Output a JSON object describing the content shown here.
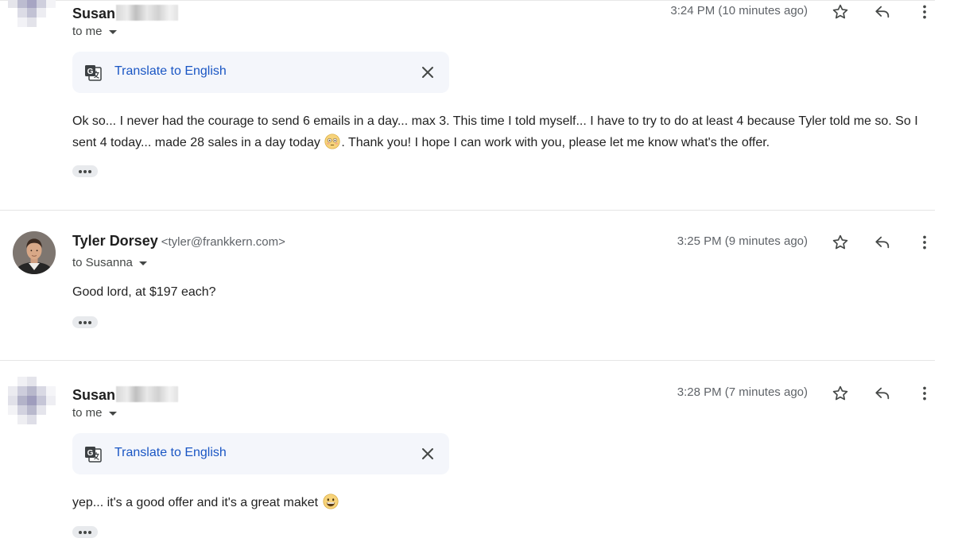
{
  "messages": [
    {
      "sender_name": "Susan",
      "sender_email": "",
      "to_label": "to me",
      "time": "3:24 PM (10 minutes ago)",
      "translate_label": "Translate to English",
      "body_before_emoji": "Ok so... I never had the courage to send 6 emails in a day... max 3. This time I told myself... I have to try to do at least 4 because Tyler told me so. So I sent 4 today... made 28 sales in a day today",
      "emoji": "flushed-face-emoji",
      "body_after_emoji": ". Thank you! I hope I can work with you, please let me know what's the offer."
    },
    {
      "sender_name": "Tyler Dorsey",
      "sender_email": "<tyler@frankkern.com>",
      "to_label": "to Susanna",
      "time": "3:25 PM (9 minutes ago)",
      "body_before_emoji": "Good lord, at $197 each?"
    },
    {
      "sender_name": "Susan",
      "sender_email": "",
      "to_label": "to me",
      "time": "3:28 PM (7 minutes ago)",
      "translate_label": "Translate to English",
      "body_before_emoji": "yep... it's a good offer and it's a great maket",
      "emoji": "grinning-face-emoji"
    }
  ],
  "icons": {
    "star": "star-outline-icon",
    "reply": "reply-arrow-icon",
    "more": "more-vertical-icon",
    "translate": "google-translate-icon",
    "close": "close-icon",
    "caret": "caret-down-icon",
    "ellipsis": "show-trimmed-content-icon"
  },
  "colors": {
    "link": "#1a56c4",
    "translate_bg": "#f4f6fb",
    "muted_text": "#5f6368"
  }
}
